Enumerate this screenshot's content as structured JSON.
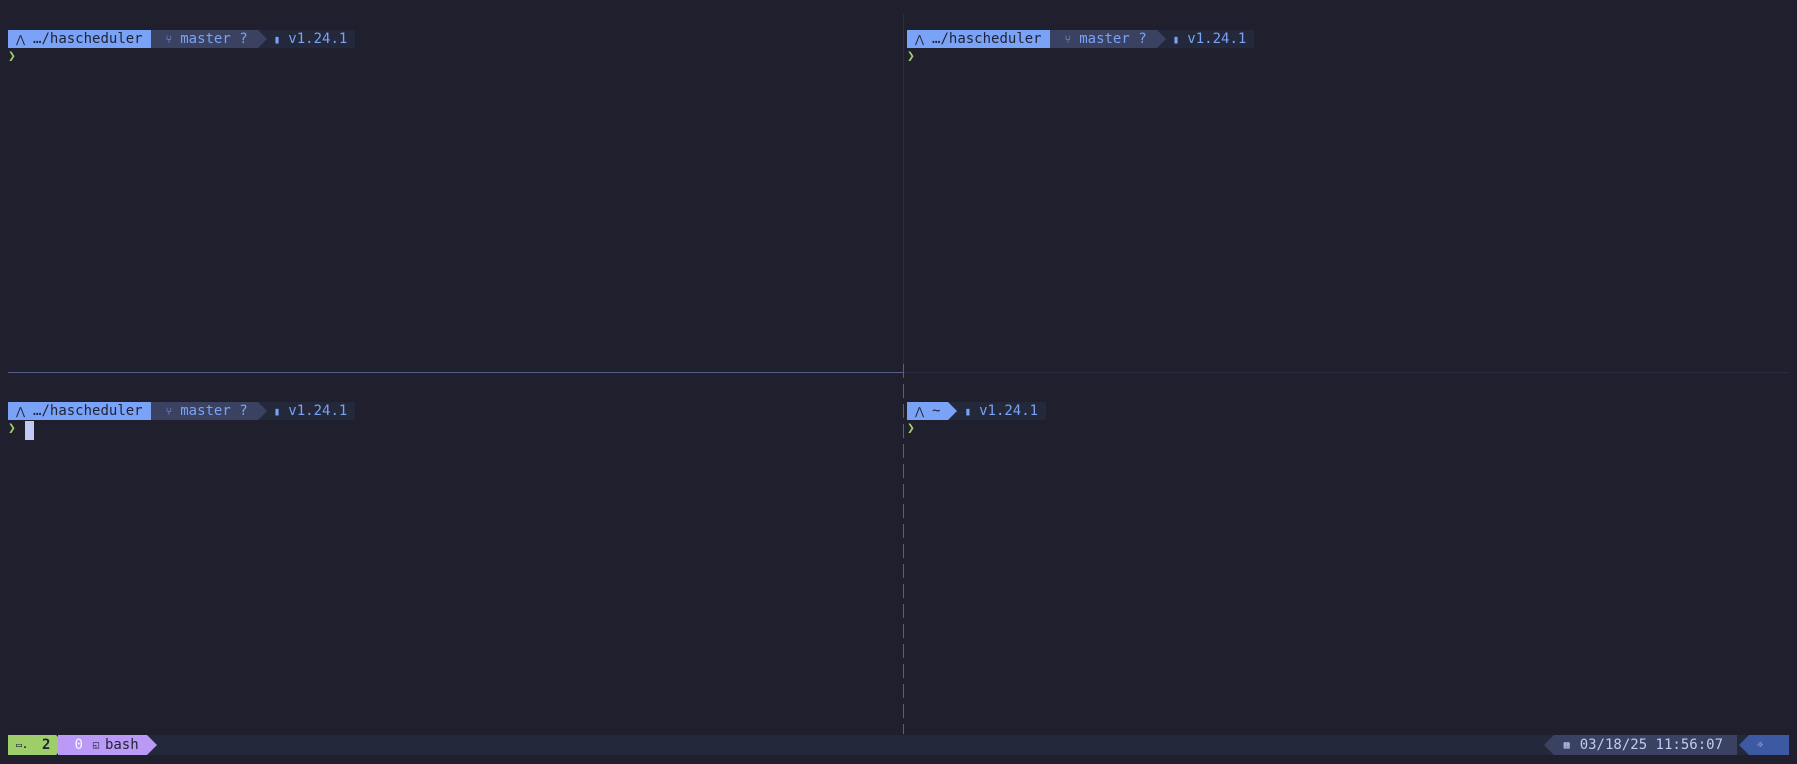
{
  "panes": [
    {
      "dir": "…/hascheduler",
      "branch": "master",
      "git_status": "?",
      "go_version": "v1.24.1",
      "prompt_char": "❯"
    },
    {
      "dir": "…/hascheduler",
      "branch": "master",
      "git_status": "?",
      "go_version": "v1.24.1",
      "prompt_char": "❯"
    },
    {
      "dir": "…/hascheduler",
      "branch": "master",
      "git_status": "?",
      "go_version": "v1.24.1",
      "prompt_char": "❯"
    },
    {
      "dir": "~",
      "go_version": "v1.24.1",
      "prompt_char": "❯"
    }
  ],
  "icons": {
    "os": "arch-icon",
    "branch": "git-branch-icon",
    "go": "go-gopher-icon",
    "session": "terminal-icon",
    "window": "window-icon",
    "calendar": "calendar-icon",
    "theme": "sun-icon"
  },
  "statusbar": {
    "session": "2",
    "window_index": "0",
    "window_name": "bash",
    "datetime": "03/18/25 11:56:07"
  },
  "colors": {
    "bg": "#1f1f2d",
    "dir_bg": "#7aa2f7",
    "git_bg": "#3b4261",
    "accent_green": "#9ece6a",
    "accent_purple": "#bb9af7"
  }
}
